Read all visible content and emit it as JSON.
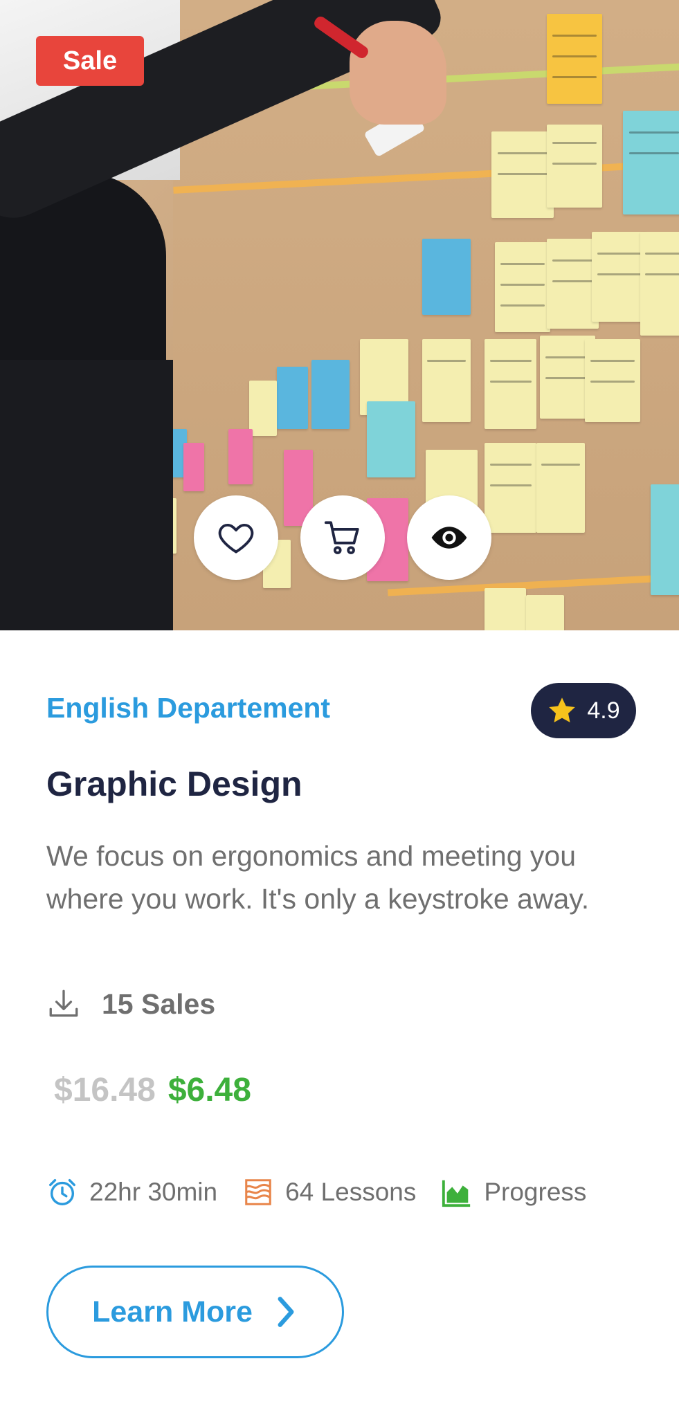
{
  "badge": {
    "sale_label": "Sale"
  },
  "actions": {
    "wishlist_icon": "heart-icon",
    "cart_icon": "cart-icon",
    "view_icon": "eye-icon"
  },
  "course": {
    "department": "English Departement",
    "rating": "4.9",
    "title": "Graphic Design",
    "description": "We focus on ergonomics and meeting you where you work. It's only a keystroke away.",
    "sales": "15 Sales",
    "old_price": "$16.48",
    "new_price": "$6.48",
    "duration": "22hr 30min",
    "lessons": "64 Lessons",
    "progress": "Progress",
    "cta": "Learn More"
  },
  "colors": {
    "accent_blue": "#2b9bde",
    "sale_red": "#e8453c",
    "price_green": "#3db03b",
    "lessons_orange": "#e8854a",
    "rating_bg": "#1f2542",
    "star_yellow": "#f6c21c"
  }
}
